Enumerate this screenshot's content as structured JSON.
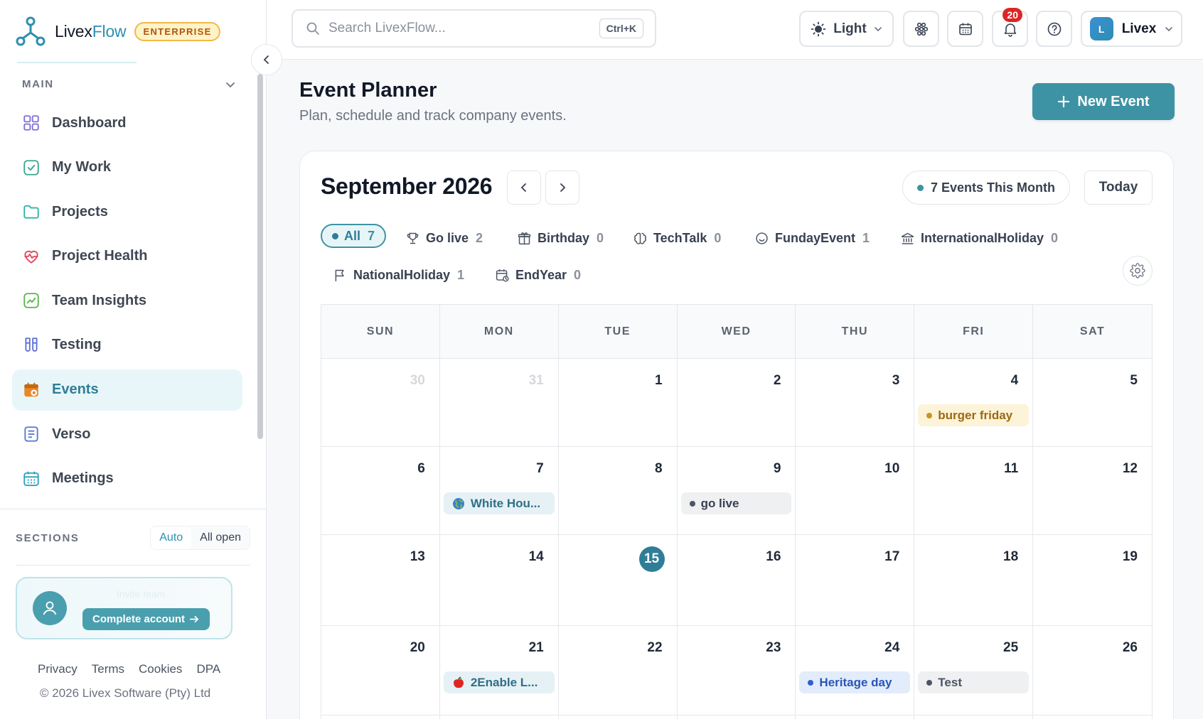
{
  "brand": {
    "name_a": "Livex",
    "name_b": "Flow",
    "badge": "ENTERPRISE"
  },
  "sidebar": {
    "section_label": "MAIN",
    "items": [
      {
        "label": "Dashboard",
        "icon": "grid-icon",
        "color": "#7c6fd6"
      },
      {
        "label": "My Work",
        "icon": "check-square-icon",
        "color": "#3aa58f"
      },
      {
        "label": "Projects",
        "icon": "folder-icon",
        "color": "#2fb3a3"
      },
      {
        "label": "Project Health",
        "icon": "heart-pulse-icon",
        "color": "#e0475b"
      },
      {
        "label": "Team Insights",
        "icon": "trend-chart-icon",
        "color": "#5ab34a"
      },
      {
        "label": "Testing",
        "icon": "test-tubes-icon",
        "color": "#5b6fd8"
      },
      {
        "label": "Events",
        "icon": "calendar-star-icon",
        "color": "#e7892b",
        "active": true
      },
      {
        "label": "Verso",
        "icon": "document-icon",
        "color": "#5577d6"
      },
      {
        "label": "Meetings",
        "icon": "calendar-icon",
        "color": "#2f9fc0"
      }
    ],
    "sections_label": "SECTIONS",
    "sections_options": [
      "Auto",
      "All open"
    ],
    "account_ghost": "Invite team",
    "complete_account": "Complete account",
    "footer_links": [
      "Privacy",
      "Terms",
      "Cookies",
      "DPA"
    ],
    "copyright": "© 2026 Livex Software (Pty) Ltd"
  },
  "topbar": {
    "search_placeholder": "Search LivexFlow...",
    "search_shortcut": "Ctrl+K",
    "theme": "Light",
    "notification_count": "20",
    "user_initial": "L",
    "user_name": "Livex"
  },
  "page": {
    "title": "Event Planner",
    "subtitle": "Plan, schedule and track company events.",
    "new_event": "New Event"
  },
  "calendar": {
    "month": "September 2026",
    "events_count": "7 Events This Month",
    "today": "Today",
    "filters": [
      {
        "label": "All",
        "count": "7",
        "icon": "dot",
        "active": true
      },
      {
        "label": "Go live",
        "count": "2",
        "icon": "trophy-icon"
      },
      {
        "label": "Birthday",
        "count": "0",
        "icon": "gift-icon"
      },
      {
        "label": "TechTalk",
        "count": "0",
        "icon": "brain-icon"
      },
      {
        "label": "FundayEvent",
        "count": "1",
        "icon": "smile-icon"
      },
      {
        "label": "InternationalHoliday",
        "count": "0",
        "icon": "bank-icon"
      },
      {
        "label": "NationalHoliday",
        "count": "1",
        "icon": "flag-icon"
      },
      {
        "label": "EndYear",
        "count": "0",
        "icon": "calendar-clock-icon"
      }
    ],
    "weekdays": [
      "SUN",
      "MON",
      "TUE",
      "WED",
      "THU",
      "FRI",
      "SAT"
    ],
    "weeks": [
      [
        {
          "day": "30",
          "muted": true
        },
        {
          "day": "31",
          "muted": true
        },
        {
          "day": "1"
        },
        {
          "day": "2"
        },
        {
          "day": "3"
        },
        {
          "day": "4",
          "event": {
            "label": "burger friday",
            "bg": "#fdf3d8",
            "fg": "#9a6a12",
            "dot": "#c9961a"
          }
        },
        {
          "day": "5"
        }
      ],
      [
        {
          "day": "6"
        },
        {
          "day": "7",
          "event": {
            "label": "White Hou...",
            "bg": "#e6f1f6",
            "fg": "#2f6f86",
            "emoji": "globe"
          }
        },
        {
          "day": "8"
        },
        {
          "day": "9",
          "event": {
            "label": "go live",
            "bg": "#eef0f2",
            "fg": "#374151",
            "dot": "#4b5563"
          }
        },
        {
          "day": "10"
        },
        {
          "day": "11"
        },
        {
          "day": "12"
        }
      ],
      [
        {
          "day": "13"
        },
        {
          "day": "14"
        },
        {
          "day": "15",
          "today": true
        },
        {
          "day": "16"
        },
        {
          "day": "17"
        },
        {
          "day": "18"
        },
        {
          "day": "19"
        }
      ],
      [
        {
          "day": "20"
        },
        {
          "day": "21",
          "event": {
            "label": "2Enable L...",
            "bg": "#e6f1f6",
            "fg": "#2f6f86",
            "emoji": "apple"
          }
        },
        {
          "day": "22"
        },
        {
          "day": "23"
        },
        {
          "day": "24",
          "event": {
            "label": "Heritage day",
            "bg": "#e3ecfb",
            "fg": "#2a56b8",
            "dot": "#2f5fd0"
          }
        },
        {
          "day": "25",
          "event": {
            "label": "Test",
            "bg": "#eef0f2",
            "fg": "#4b5563",
            "dot": "#4b5563"
          }
        },
        {
          "day": "26"
        }
      ],
      [
        {
          "day": ""
        },
        {
          "day": ""
        },
        {
          "day": ""
        },
        {
          "day": ""
        },
        {
          "day": ""
        },
        {
          "day": ""
        },
        {
          "day": ""
        }
      ]
    ]
  }
}
